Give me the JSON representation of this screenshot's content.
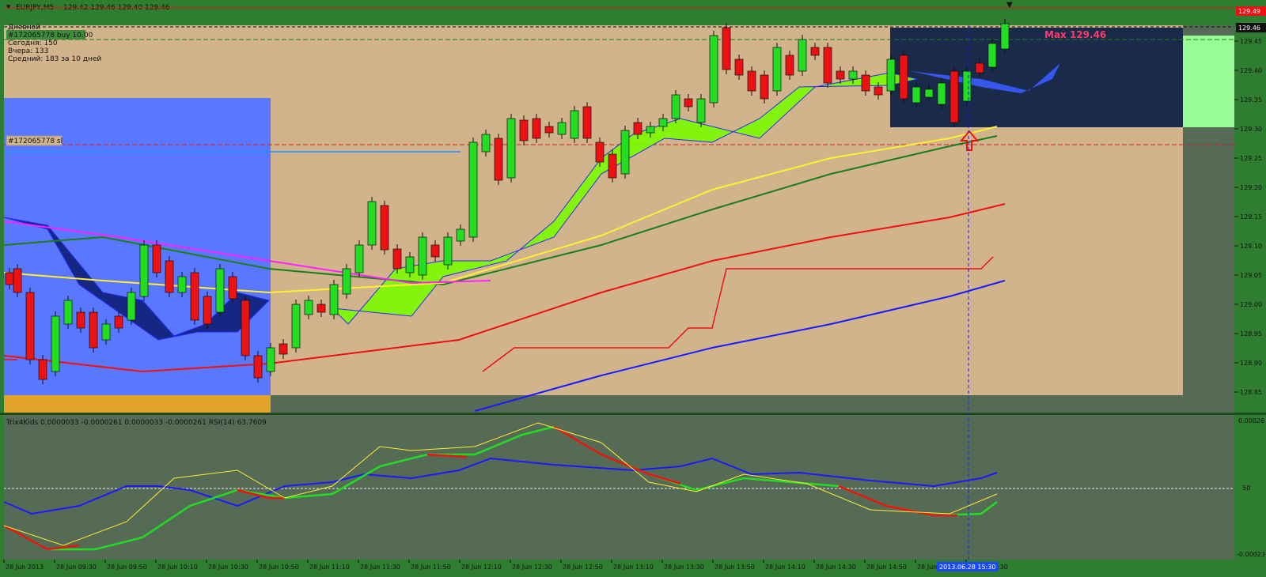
{
  "header": {
    "symbol": "EURJPY,M5",
    "ohlc": "129.42 129.46 129.40 129.46"
  },
  "account_box": {
    "lines": [
      "Дневной",
      "#172065778 buy 10.00",
      "Сегодня:  150",
      "Вчера:      133",
      "Средний:  183 за 10 дней"
    ]
  },
  "order_labels": {
    "sl": "#172065778 sl",
    "max": "Max 129.46"
  },
  "price_axis": {
    "top_label": "129.49",
    "current": "129.46",
    "ticks": [
      "129.45",
      "129.40",
      "129.35",
      "129.30",
      "129.25",
      "129.20",
      "129.15",
      "129.10",
      "129.05",
      "129.00",
      "128.95",
      "128.90",
      "128.85"
    ]
  },
  "indicator": {
    "title": "Trix4Kids 0.0000033 -0.0000261 0.0000033 -0.0000261 RSI(14) 63.7609",
    "axis_top": "0.00026",
    "axis_mid": "50",
    "axis_bottom": "-0.00023"
  },
  "time_axis": {
    "labels": [
      "28 Jun 2013",
      "28 Jun 09:30",
      "28 Jun 09:50",
      "28 Jun 10:10",
      "28 Jun 10:30",
      "28 Jun 10:50",
      "28 Jun 11:10",
      "28 Jun 11:30",
      "28 Jun 11:50",
      "28 Jun 12:10",
      "28 Jun 12:30",
      "28 Jun 12:50",
      "28 Jun 13:10",
      "28 Jun 13:30",
      "28 Jun 13:50",
      "28 Jun 14:10",
      "28 Jun 14:30",
      "28 Jun 14:50",
      "28 Jun 15:10",
      "28 Jun 15:30"
    ],
    "cursor_label": "2013.06.28 15:30"
  },
  "colors": {
    "bull": "#22dd22",
    "bear": "#ee1111",
    "background": "#d2b48c",
    "blue_zone": "#5a78ff",
    "dark_zone": "#1a2a4a"
  }
}
